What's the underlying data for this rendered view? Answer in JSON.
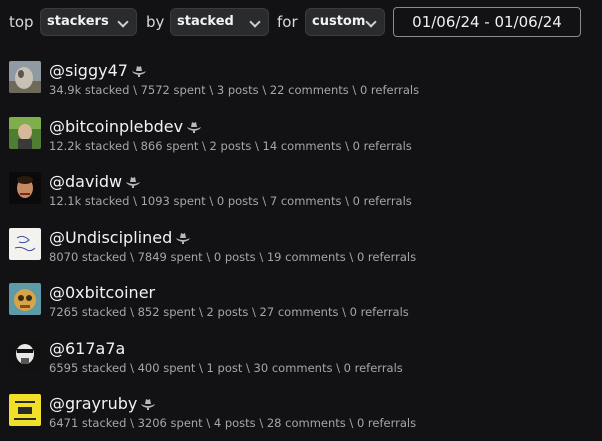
{
  "filters": {
    "top_label": "top",
    "what_value": "stackers",
    "by_label": "by",
    "by_value": "stacked",
    "for_label": "for",
    "when_value": "custom",
    "date_range": "01/06/24 - 01/06/24"
  },
  "users": [
    {
      "name": "@siggy47",
      "stats": "34.9k stacked \\ 7572 spent \\ 3 posts \\ 22 comments \\ 0 referrals"
    },
    {
      "name": "@bitcoinplebdev",
      "stats": "12.2k stacked \\ 866 spent \\ 2 posts \\ 14 comments \\ 0 referrals"
    },
    {
      "name": "@davidw",
      "stats": "12.1k stacked \\ 1093 spent \\ 0 posts \\ 7 comments \\ 0 referrals"
    },
    {
      "name": "@Undisciplined",
      "stats": "8070 stacked \\ 7849 spent \\ 0 posts \\ 19 comments \\ 0 referrals"
    },
    {
      "name": "@0xbitcoiner",
      "stats": "7265 stacked \\ 852 spent \\ 2 posts \\ 27 comments \\ 0 referrals"
    },
    {
      "name": "@617a7a",
      "stats": "6595 stacked \\ 400 spent \\ 1 post \\ 30 comments \\ 0 referrals"
    },
    {
      "name": "@grayruby",
      "stats": "6471 stacked \\ 3206 spent \\ 4 posts \\ 28 comments \\ 0 referrals"
    }
  ],
  "colors": {
    "background": "#121214",
    "select_bg": "#2a2b2d",
    "muted_text": "#a6a6a6",
    "hat_icon": "#b8b8b8"
  }
}
